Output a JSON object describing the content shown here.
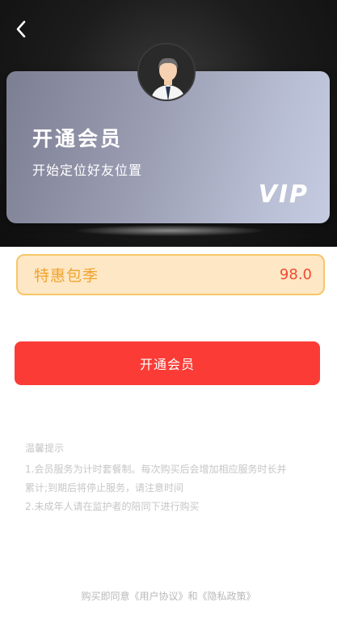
{
  "card": {
    "title": "开通会员",
    "subtitle": "开始定位好友位置",
    "badge": "VIP"
  },
  "plan": {
    "name": "特惠包季",
    "price": "98.0"
  },
  "cta_label": "开通会员",
  "tips": {
    "title": "温馨提示",
    "line1": "1.会员服务为计时套餐制。每次购买后会增加相应服务时长并",
    "line2": "累计;到期后将停止服务，请注意时间",
    "line3": "2.未成年人请在监护者的陪同下进行购买"
  },
  "footer": {
    "agreement_text": "购买即同意《用户协议》和《隐私政策》"
  },
  "colors": {
    "cta": "#fb3c36",
    "plan_bg": "#fee7c4",
    "plan_border": "#f6c667",
    "plan_text": "#f0a330",
    "price": "#ef4a33"
  }
}
